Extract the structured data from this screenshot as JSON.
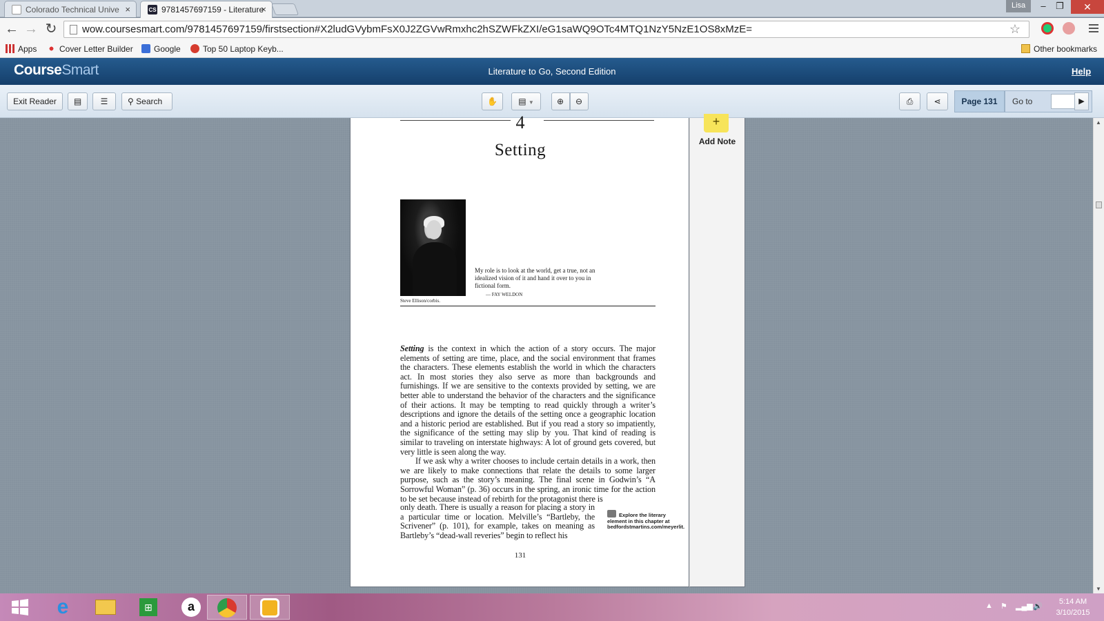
{
  "browser": {
    "tabs": [
      {
        "title": "Colorado Technical Unive"
      },
      {
        "title": "9781457697159 - Literature",
        "favicon": "CS"
      }
    ],
    "user": "Lisa",
    "url": "wow.coursesmart.com/9781457697159/firstsection#X2ludGVybmFsX0J2ZGVwRmxhc2hSZWFkZXI/eG1saWQ9OTc4MTQ1NzY5NzE1OS8xMzE="
  },
  "bookmarks": {
    "items": [
      "Apps",
      "Cover Letter Builder",
      "Google",
      "Top 50 Laptop Keyb..."
    ],
    "other": "Other bookmarks"
  },
  "coursesmart": {
    "logo_a": "Course",
    "logo_b": "Smart",
    "book_title": "Literature to Go, Second Edition",
    "help": "Help"
  },
  "toolbar": {
    "exit_reader": "Exit Reader",
    "search": "Search",
    "page_label": "Page 131",
    "goto_label": "Go to",
    "goto_value": ""
  },
  "sidebar": {
    "add_note": "Add Note",
    "plus": "+"
  },
  "page": {
    "chapter_number": "4",
    "chapter_title": "Setting",
    "photo_credit": "Steve Ellison/corbis.",
    "epigraph": "My role is to look at the world, get a true, not an idealized vision of it and hand it over to you in fictional form.",
    "epigraph_author": "— FAY WELDON",
    "para1_term": "Setting",
    "para1": " is the context in which the action of a story occurs. The major elements of setting are time, place, and the social environment that frames the characters. These elements establish the world in which the characters act. In most stories they also serve as more than backgrounds and furnishings. If we are sensitive to the contexts provided by setting, we are better able to understand the behavior of the characters and the significance of their actions. It may be tempting to read quickly through a writer’s descriptions and ignore the details of the setting once a geographic location and a historic period are established. But if you read a story so impatiently, the significance of the setting may slip by you. That kind of reading is similar to traveling on interstate highways: A lot of ground gets covered, but very little is seen along the way.",
    "para2": "If we ask why a writer chooses to include certain details in a work, then we are likely to make connections that relate the details to some larger purpose, such as the story’s meaning. The final scene in Godwin’s “A Sorrowful Woman” (p. 36) occurs in the spring, an ironic time for the action to be set because instead of rebirth for the protagonist there is",
    "para2_narrow": "only death. There is usually a reason for placing a story in a particular time or location. Melville’s “Bartleby, the Scrivener” (p. 101), for example, takes on meaning as Bartleby’s “dead-wall reveries” begin to reflect his",
    "margin_note": "Explore the literary element in this chapter at bedfordstmartins.com/meyerlit.",
    "folio": "131"
  },
  "taskbar": {
    "clock_time": "5:14 AM",
    "clock_date": "3/10/2015"
  }
}
